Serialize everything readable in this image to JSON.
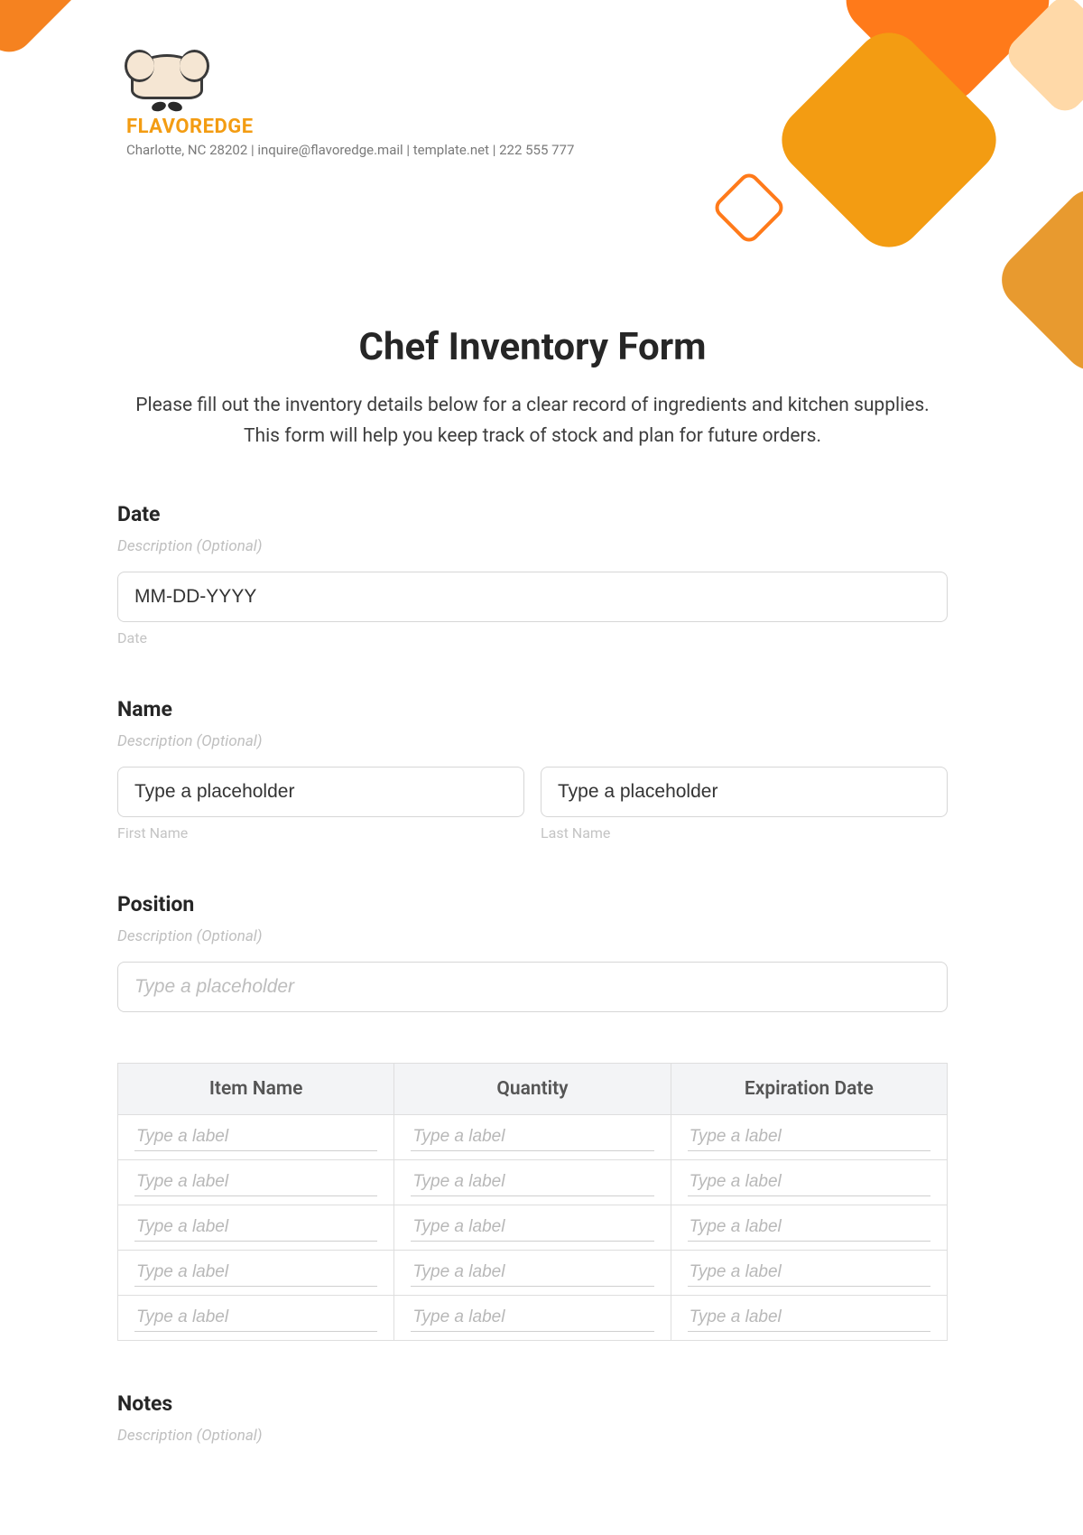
{
  "brand": {
    "name": "FLAVOREDGE",
    "contact": "Charlotte, NC 28202 | inquire@flavoredge.mail | template.net | 222 555 777"
  },
  "form": {
    "title": "Chef Inventory Form",
    "intro": "Please fill out the inventory details below for a clear record of ingredients and kitchen supplies. This form will help you keep track of stock and plan for future orders."
  },
  "fields": {
    "date": {
      "label": "Date",
      "desc": "Description (Optional)",
      "placeholder": "MM-DD-YYYY",
      "sub": "Date"
    },
    "name": {
      "label": "Name",
      "desc": "Description (Optional)",
      "first_placeholder": "Type a placeholder",
      "last_placeholder": "Type a placeholder",
      "first_sub": "First Name",
      "last_sub": "Last Name"
    },
    "position": {
      "label": "Position",
      "desc": "Description (Optional)",
      "placeholder": "Type a placeholder"
    },
    "notes": {
      "label": "Notes",
      "desc": "Description (Optional)"
    }
  },
  "table": {
    "headers": [
      "Item Name",
      "Quantity",
      "Expiration Date"
    ],
    "cell_placeholder": "Type a label",
    "rows": 5
  }
}
